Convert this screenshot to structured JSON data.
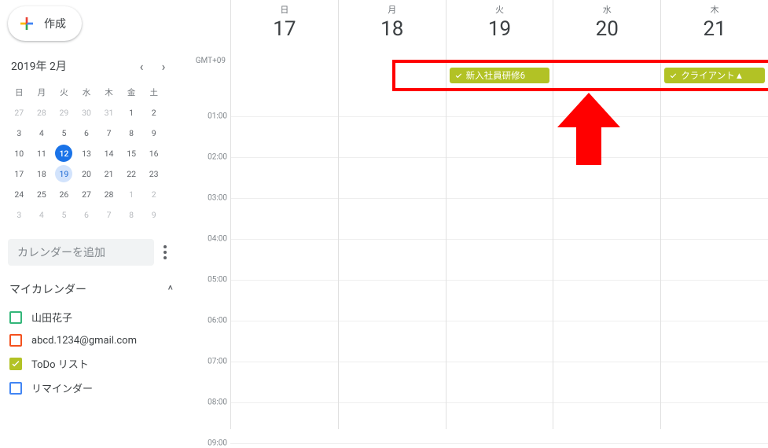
{
  "create_label": "作成",
  "mini_cal": {
    "title": "2019年 2月",
    "dow": [
      "日",
      "月",
      "火",
      "水",
      "木",
      "金",
      "土"
    ],
    "cells": [
      [
        {
          "n": "27",
          "out": true
        },
        {
          "n": "28",
          "out": true
        },
        {
          "n": "29",
          "out": true
        },
        {
          "n": "30",
          "out": true
        },
        {
          "n": "31",
          "out": true
        },
        {
          "n": "1"
        },
        {
          "n": "2"
        }
      ],
      [
        {
          "n": "3"
        },
        {
          "n": "4"
        },
        {
          "n": "5"
        },
        {
          "n": "6"
        },
        {
          "n": "7"
        },
        {
          "n": "8"
        },
        {
          "n": "9"
        }
      ],
      [
        {
          "n": "10"
        },
        {
          "n": "11"
        },
        {
          "n": "12",
          "today": true
        },
        {
          "n": "13"
        },
        {
          "n": "14"
        },
        {
          "n": "15"
        },
        {
          "n": "16"
        }
      ],
      [
        {
          "n": "17"
        },
        {
          "n": "18"
        },
        {
          "n": "19",
          "sel": true
        },
        {
          "n": "20"
        },
        {
          "n": "21"
        },
        {
          "n": "22"
        },
        {
          "n": "23"
        }
      ],
      [
        {
          "n": "24"
        },
        {
          "n": "25"
        },
        {
          "n": "26"
        },
        {
          "n": "27"
        },
        {
          "n": "28"
        },
        {
          "n": "1",
          "out": true
        },
        {
          "n": "2",
          "out": true
        }
      ],
      [
        {
          "n": "3",
          "out": true
        },
        {
          "n": "4",
          "out": true
        },
        {
          "n": "5",
          "out": true
        },
        {
          "n": "6",
          "out": true
        },
        {
          "n": "7",
          "out": true
        },
        {
          "n": "8",
          "out": true
        },
        {
          "n": "9",
          "out": true
        }
      ]
    ]
  },
  "add_calendar_placeholder": "カレンダーを追加",
  "my_calendars_label": "マイカレンダー",
  "calendars": [
    {
      "label": "山田花子",
      "color": "#33b679",
      "checked": false
    },
    {
      "label": "abcd.1234@gmail.com",
      "color": "#f4511e",
      "checked": false
    },
    {
      "label": "ToDo リスト",
      "color": "#b2c225",
      "checked": true
    },
    {
      "label": "リマインダー",
      "color": "#4285f4",
      "checked": false
    }
  ],
  "grid": {
    "tz": "GMT+09",
    "days": [
      {
        "dow": "日",
        "num": "17"
      },
      {
        "dow": "月",
        "num": "18"
      },
      {
        "dow": "火",
        "num": "19"
      },
      {
        "dow": "水",
        "num": "20"
      },
      {
        "dow": "木",
        "num": "21"
      }
    ],
    "hours": [
      "01:00",
      "02:00",
      "03:00",
      "04:00",
      "05:00",
      "06:00",
      "07:00",
      "08:00",
      "09:00"
    ]
  },
  "events": [
    {
      "col": 2,
      "label": "新入社員研修6"
    },
    {
      "col": 4,
      "label": "クライアント▲"
    }
  ]
}
